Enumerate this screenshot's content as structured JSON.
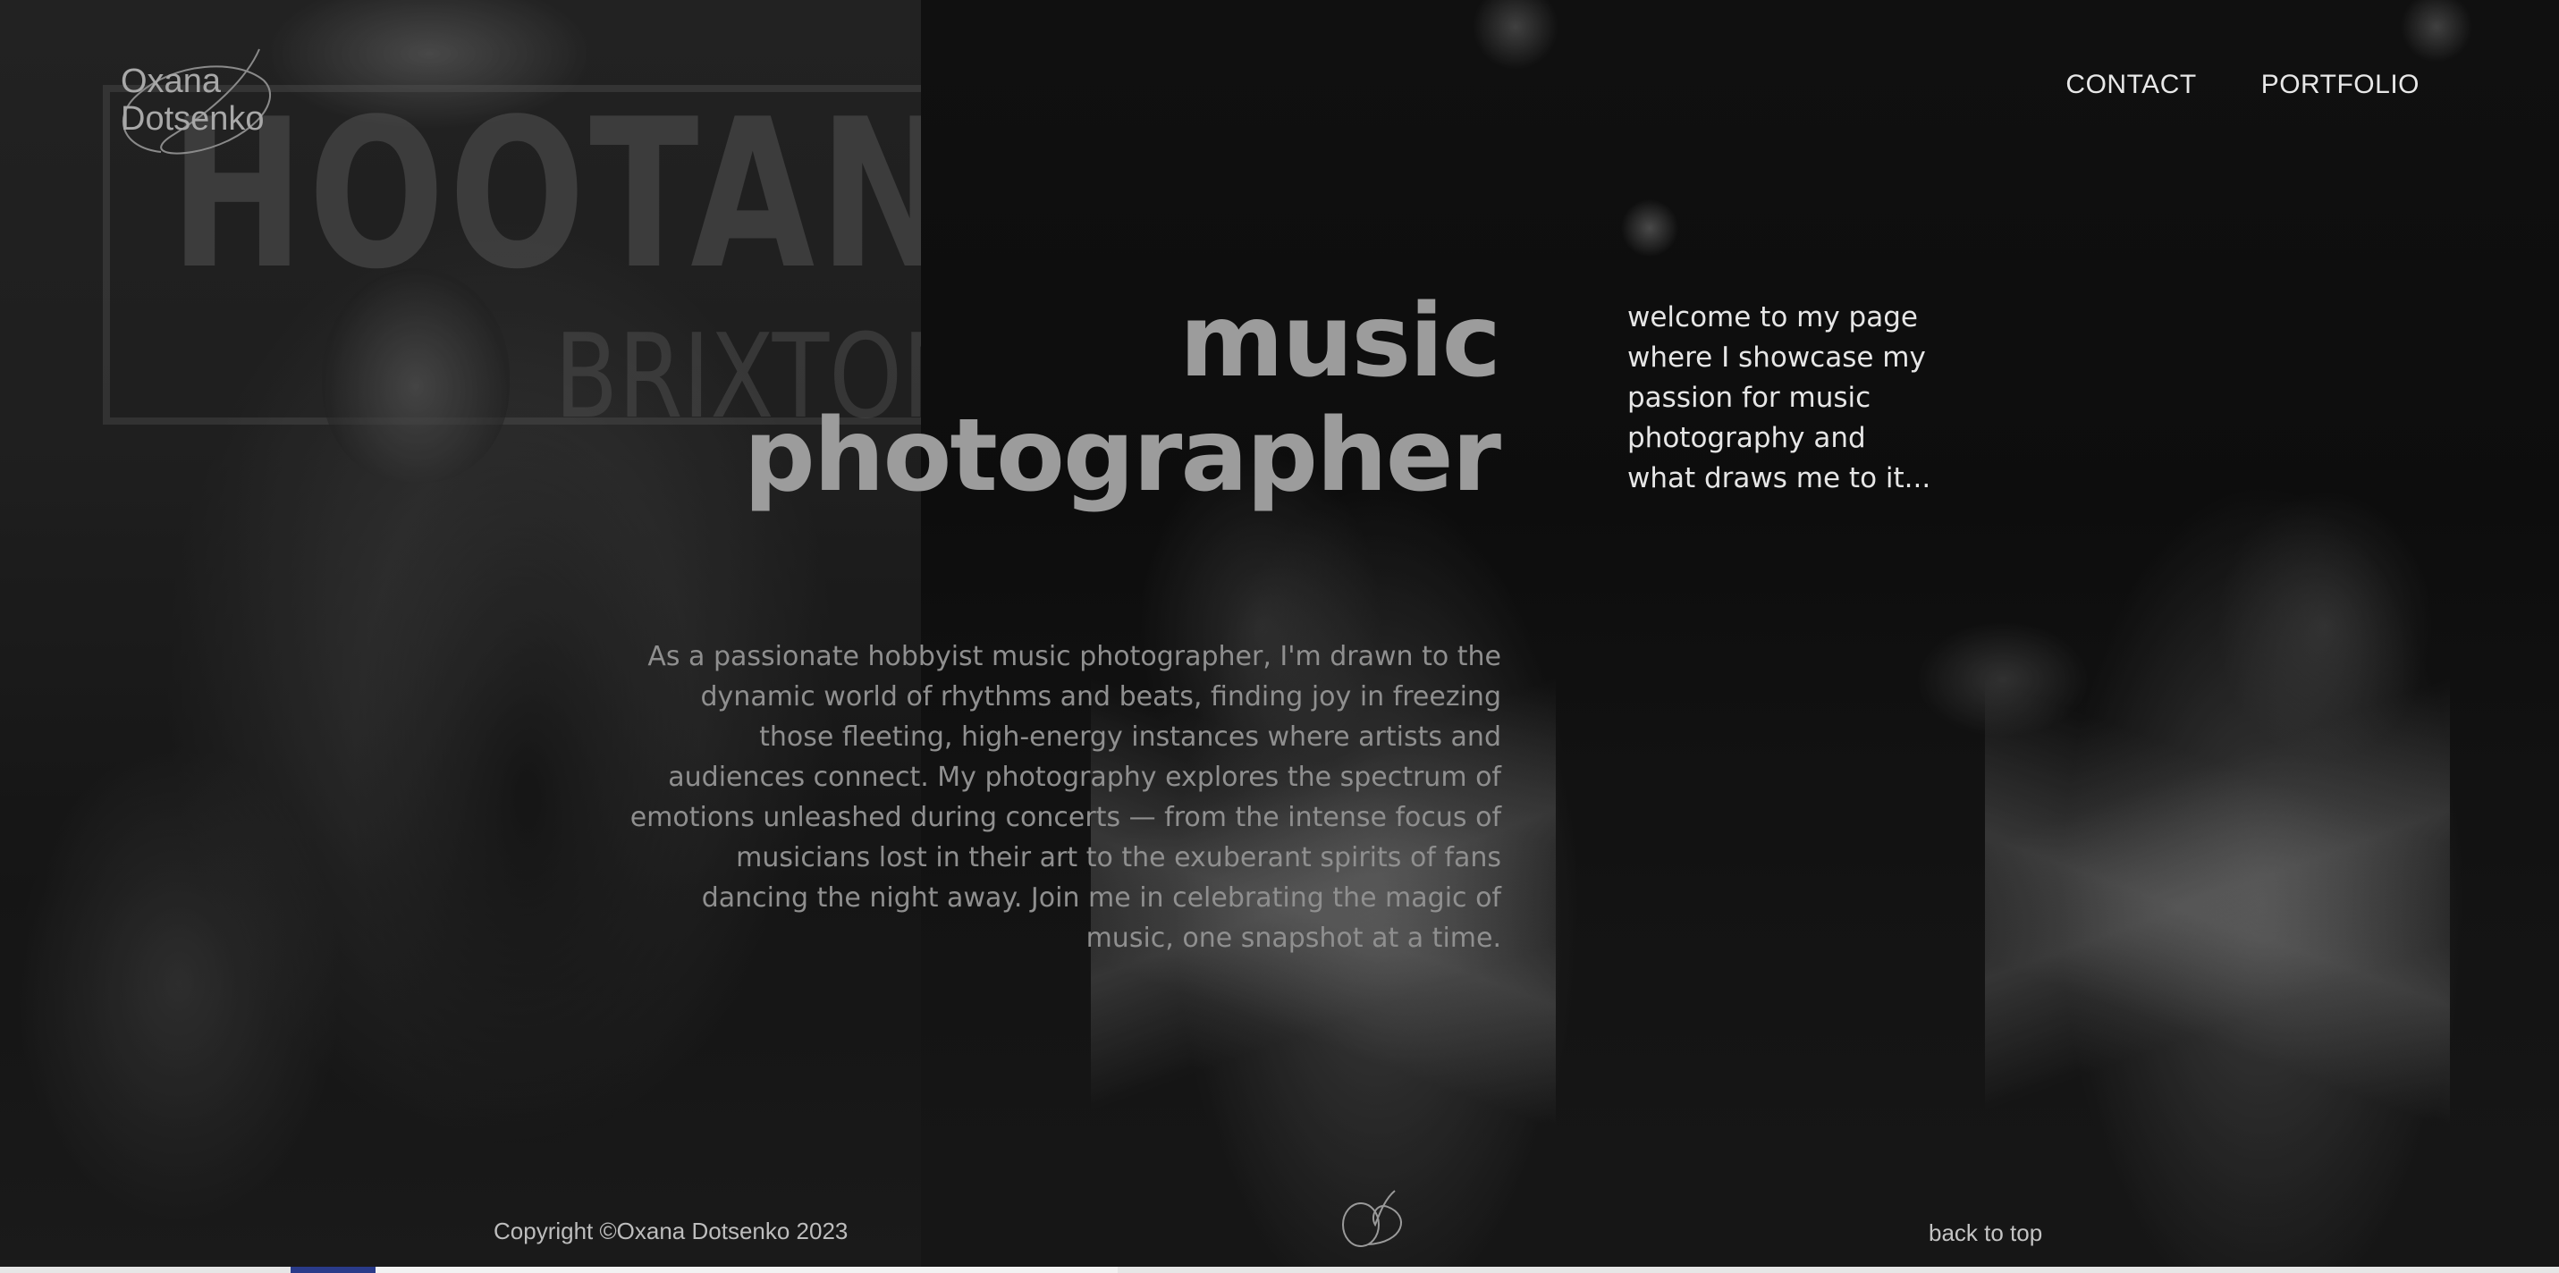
{
  "logo": {
    "line1": "Oxana",
    "line2": "Dotsenko"
  },
  "nav": {
    "items": [
      {
        "label": "CONTACT"
      },
      {
        "label": "PORTFOLIO"
      }
    ]
  },
  "background": {
    "banner_text": "HOOTANA",
    "banner_sub": "BRIXTON"
  },
  "hero": {
    "title_line1": "music",
    "title_line2": "photographer",
    "welcome": "welcome to my page where I showcase my passion for music photography and what draws me to it...",
    "about_lines": [
      "As a passionate hobbyist music photographer, I'm drawn to the",
      "dynamic world of rhythms and beats, finding joy in freezing",
      "those fleeting, high-energy instances where artists and",
      "audiences connect. My photography explores the spectrum of",
      "emotions unleashed during concerts — from the intense focus of",
      "musicians lost in their art to the exuberant spirits of fans",
      "dancing the night away. Join me in celebrating the magic of",
      "music, one snapshot at a time."
    ]
  },
  "footer": {
    "copyright": "Copyright ©Oxana Dotsenko 2023",
    "back_to_top": "back to top"
  },
  "colors": {
    "page_bg": "#0a0a0a",
    "title": "#9c9c9c",
    "nav_text": "#e8e8e8",
    "body_text": "#8f8f8f",
    "welcome_text": "#e6e6e6"
  }
}
